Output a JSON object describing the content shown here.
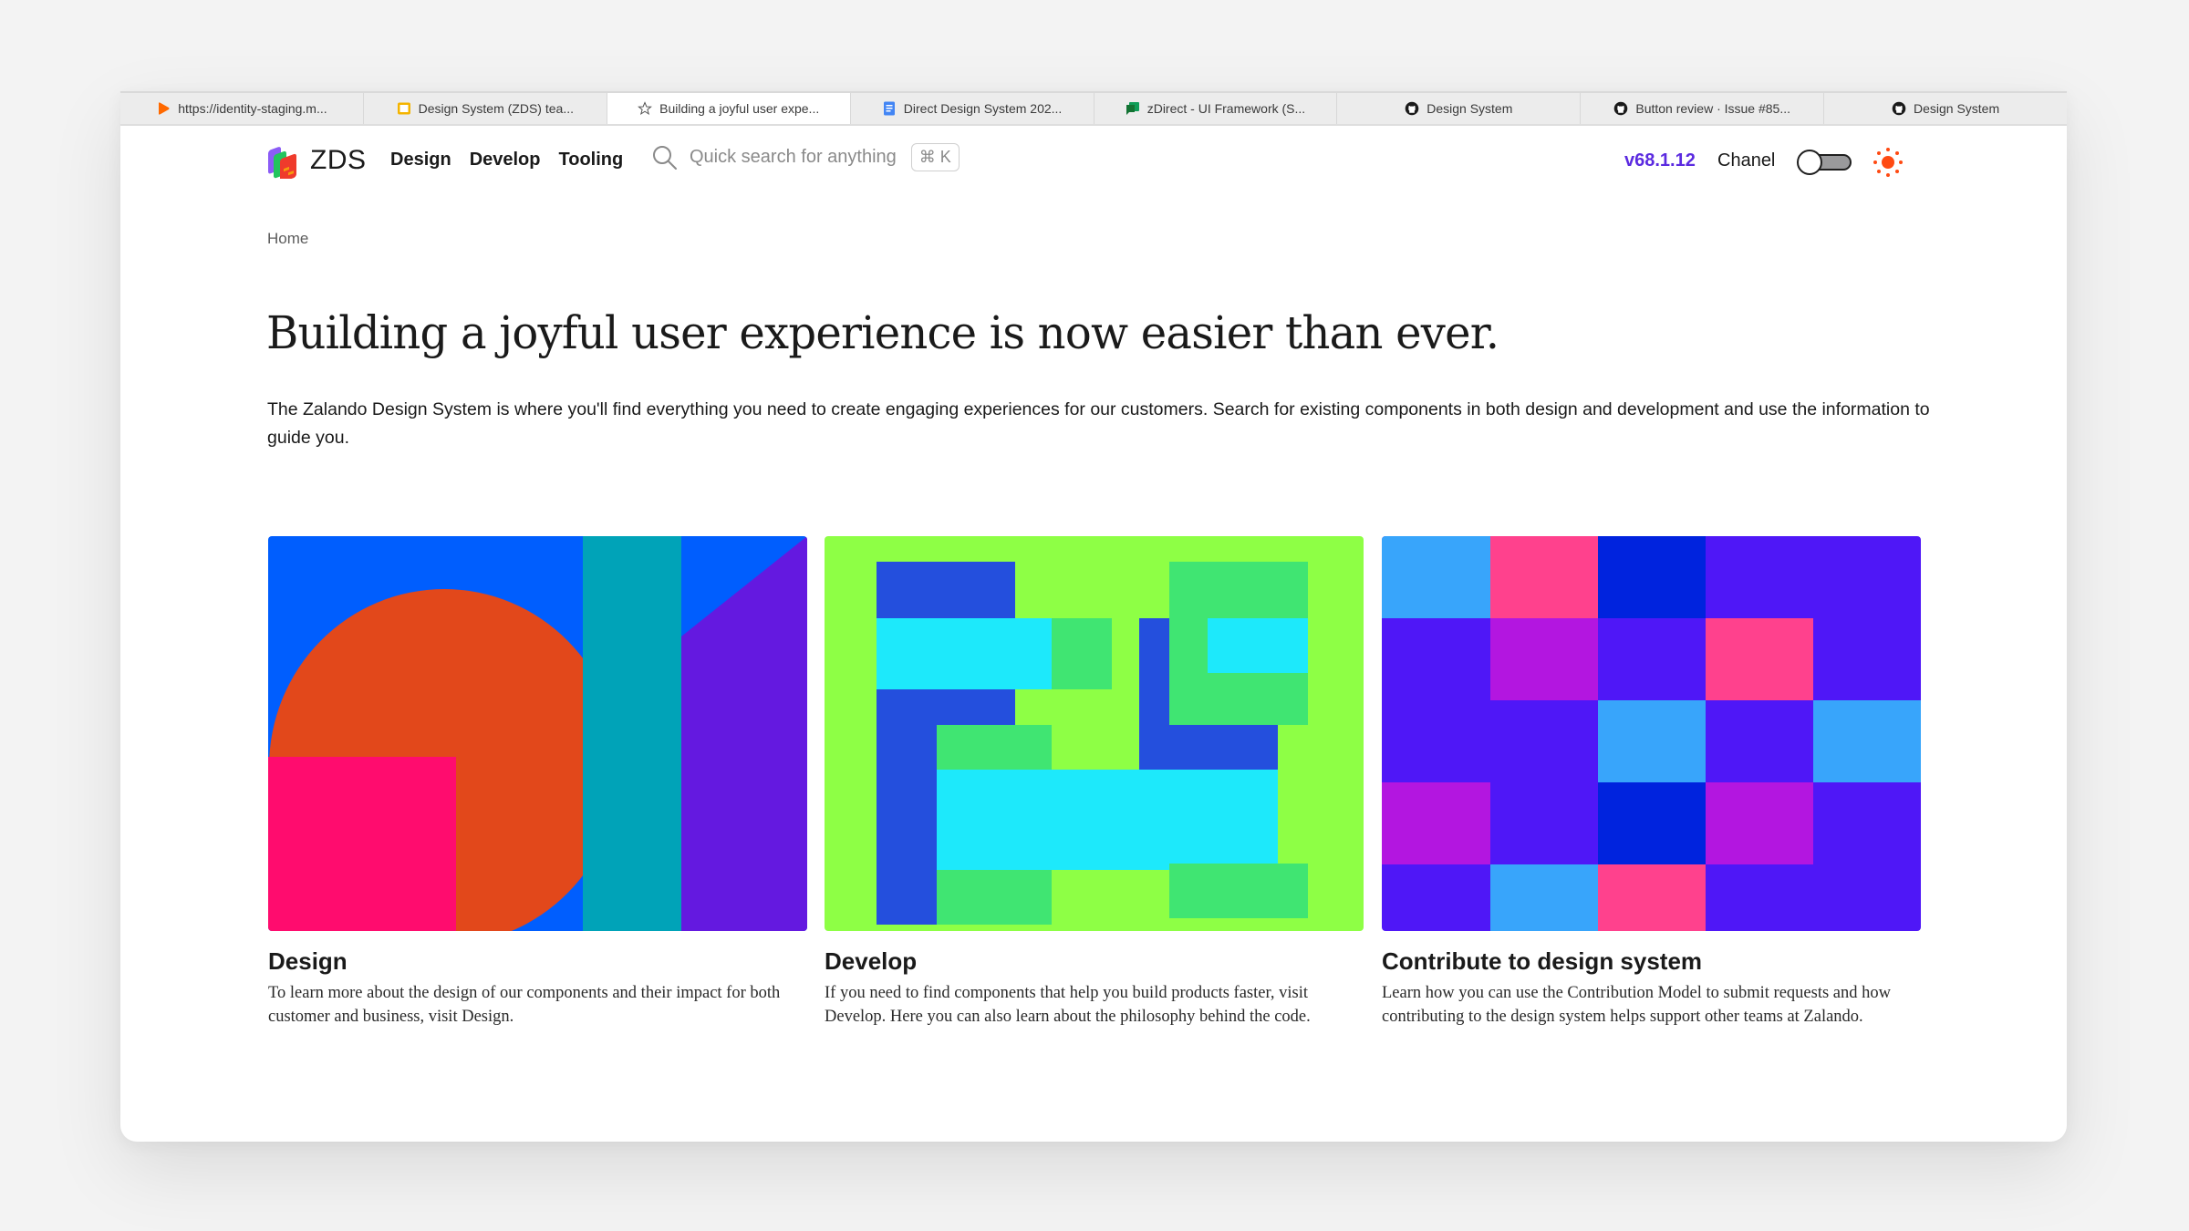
{
  "browser": {
    "tabs": [
      {
        "label": "https://identity-staging.m...",
        "icon": "zalando-play-icon",
        "active": false
      },
      {
        "label": "Design System (ZDS) tea...",
        "icon": "slides-icon",
        "active": false
      },
      {
        "label": "Building a joyful user expe...",
        "icon": "star-icon",
        "active": true
      },
      {
        "label": "Direct Design System 202...",
        "icon": "docs-icon",
        "active": false
      },
      {
        "label": "zDirect - UI Framework (S...",
        "icon": "chat-icon",
        "active": false
      },
      {
        "label": "Design System",
        "icon": "github-icon",
        "active": false
      },
      {
        "label": "Button review · Issue #85...",
        "icon": "github-icon",
        "active": false
      },
      {
        "label": "Design System",
        "icon": "github-icon",
        "active": false
      }
    ]
  },
  "header": {
    "logo_text": "ZDS",
    "nav": [
      "Design",
      "Develop",
      "Tooling"
    ],
    "search_placeholder": "Quick search for anything",
    "shortcut": "⌘ K",
    "version": "v68.1.12",
    "theme_label": "Chanel",
    "toggle_on": false
  },
  "breadcrumb": "Home",
  "headline": "Building a joyful user experience is now easier than ever.",
  "intro": "The Zalando Design System is where you'll find everything you need to create engaging experiences for our customers. Search for existing components in both design and development and use the information to guide you.",
  "cards": [
    {
      "title": "Design",
      "description": "To learn more about the design of our components and their impact for both customer and business, visit Design."
    },
    {
      "title": "Develop",
      "description": "If you need to find components that help you build products faster, visit Develop. Here you can also learn about the philosophy behind the code."
    },
    {
      "title": "Contribute to design system",
      "description": "Learn how you can use the Contribution Model to submit requests and how contributing to the design system helps support other teams at Zalando."
    }
  ],
  "colors": {
    "accent": "#5b2ae0",
    "sun": "#ff4a12"
  }
}
